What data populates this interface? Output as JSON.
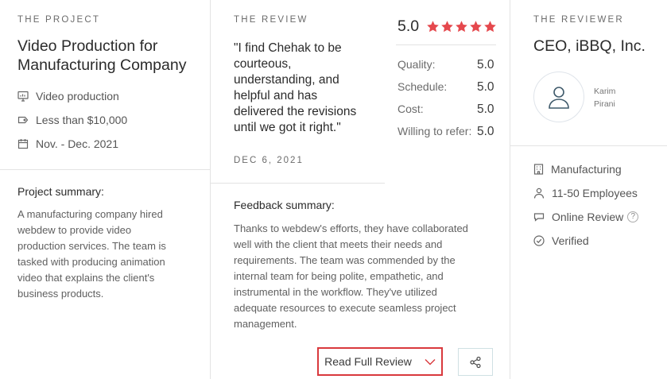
{
  "project": {
    "eyebrow": "THE PROJECT",
    "title_line1": "Video Production for",
    "title_line2": "Manufacturing Company",
    "service": "Video production",
    "budget": "Less than $10,000",
    "dates": "Nov. - Dec. 2021",
    "summary_label": "Project summary:",
    "summary_lines": [
      "A manufacturing company hired",
      "webdew to provide video",
      "production services. The team is",
      "tasked with producing animation",
      "video that explains the client's",
      "business products."
    ]
  },
  "review": {
    "eyebrow": "THE REVIEW",
    "quote_lines": [
      "\"I find Chehak to be",
      "courteous,",
      "understanding, and",
      "helpful and has",
      "delivered the revisions",
      "until we got it right.\""
    ],
    "date": "DEC 6, 2021",
    "overall_score": "5.0",
    "star_count": 5,
    "star_color": "#e5484d",
    "scores": [
      {
        "label": "Quality:",
        "value": "5.0"
      },
      {
        "label": "Schedule:",
        "value": "5.0"
      },
      {
        "label": "Cost:",
        "value": "5.0"
      },
      {
        "label": "Willing to refer:",
        "value": "5.0"
      }
    ],
    "feedback_label": "Feedback summary:",
    "feedback_lines": [
      "Thanks to webdew's efforts, they have collaborated",
      "well with the client that meets their needs and",
      "requirements. The team was commended by the",
      "internal team for being polite, empathetic, and",
      "instrumental in the workflow. They've utilized",
      "adequate resources to execute seamless project",
      "management."
    ],
    "read_full_label": "Read Full Review",
    "accent_color": "#d9393d"
  },
  "reviewer": {
    "eyebrow": "THE REVIEWER",
    "title": "CEO, iBBQ, Inc.",
    "first_name": "Karim",
    "last_name": "Pirani",
    "industry": "Manufacturing",
    "employees": "11-50 Employees",
    "review_type": "Online Review",
    "verified": "Verified"
  }
}
